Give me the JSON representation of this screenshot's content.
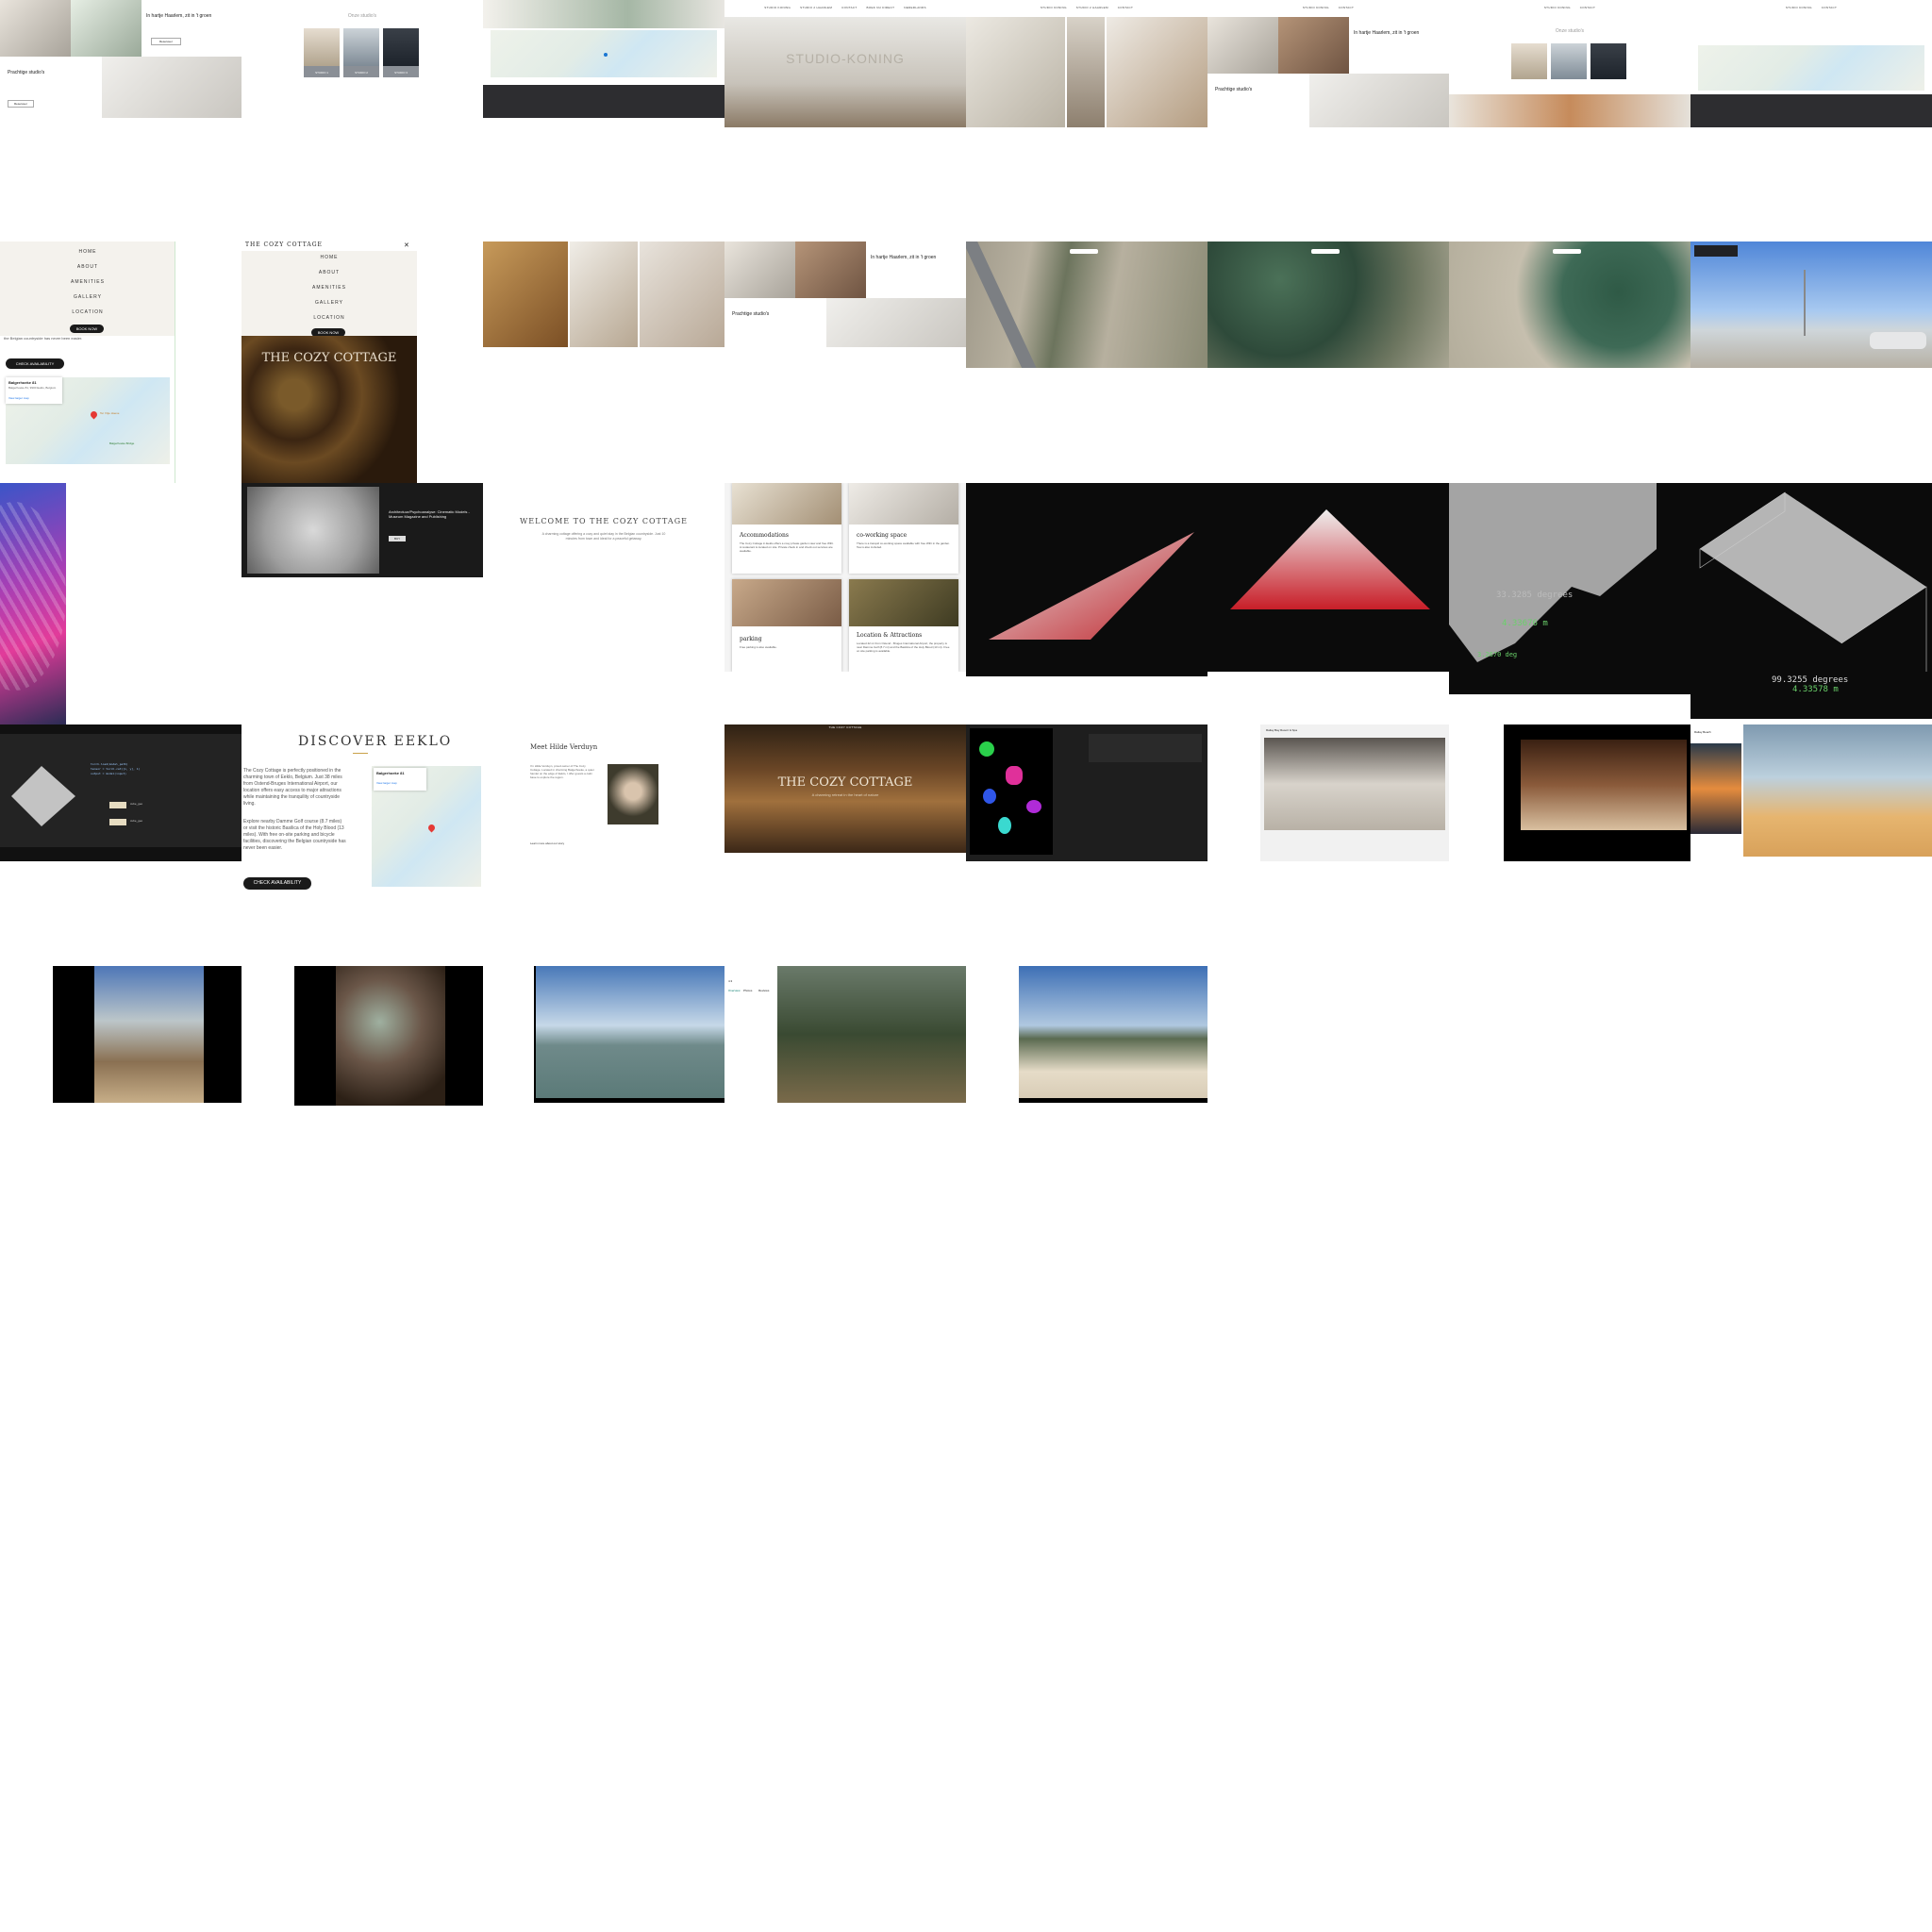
{
  "studio": {
    "nav_items": [
      "STUDIO KONING",
      "STUDIO 2 HAARLEM",
      "CONTACT",
      "BOEK NU DIRECT",
      "NEDERLANDS"
    ],
    "hero_title": "STUDIO-KONING",
    "heading_green": "In hartje Haarlem, zit in 't groen",
    "heading_studios": "Prachtige studio's",
    "read_more": "Reserveer",
    "gallery_labels": [
      "STUDIO 1",
      "STUDIO 2",
      "STUDIO 3"
    ],
    "gallery_title": "Onze studio's"
  },
  "cozy": {
    "brand": "THE COZY COTTAGE",
    "menu": [
      "HOME",
      "ABOUT",
      "AMENITIES",
      "GALLERY",
      "LOCATION"
    ],
    "book_now": "BOOK NOW",
    "check_availability": "CHECK AVAILABILITY",
    "countryside_snippet": "the Belgian countryside has never been easier.",
    "welcome_title": "WELCOME TO THE COZY COTTAGE",
    "welcome_text": "A charming cottage offering a cozy and quiet stay in the Belgian countryside. Just 10 minutes from town and ideal for a peaceful getaway.",
    "amenities": [
      {
        "title": "Accommodations",
        "text": "The Cozy Cottage in Eeklo offers a cosy private garden view and free WiFi. A restaurant is located on site. Private check in and check out services are available."
      },
      {
        "title": "co-working space",
        "text": "There is a tranquil co-working space available with free WiFi in the garden. Tea is also included."
      },
      {
        "title": "parking",
        "text": "Free parking is also available."
      },
      {
        "title": "Location & Attractions",
        "text": "Located 42 mi from Ostend - Bruges International Airport, the property is near Damme Golf (8.7 mi) and the Basilica of the Holy Blood (13 mi). Free on site parking is available."
      }
    ],
    "discover_title": "DISCOVER EEKLO",
    "discover_p1": "The Cozy Cottage is perfectly positioned in the charming town of Eeklo, Belgium. Just 38 miles from Ostend-Bruges International Airport, our location offers easy access to major attractions while maintaining the tranquility of countryside living.",
    "discover_p2": "Explore nearby Damme Golf course (8.7 miles) or visit the historic Basilica of the Holy Blood (13 miles). With free on-site parking and bicycle facilities, discovering the Belgian countryside has never been easier.",
    "map_place": "Balgerhoeke 81",
    "map_address": "Balgerhoeke 81, 9900 Eeklo, Belgium",
    "map_link": "View larger map",
    "map_pins": [
      "Ter Vrije Hoeve",
      "Balgerhoeke Bridge"
    ],
    "meet_title": "Meet Hilde Verduyn",
    "meet_text": "I'm Hilde Verduyn, proud owner of The Cozy Cottage. Located in charming Balgerhoeke, a quiet hamlet on the edge of Eeklo, I offer guests a calm base to explore the region.",
    "meet_link": "Learn more about our story",
    "hero_caption": "A charming retreat in the heart of nature"
  },
  "product": {
    "title": "Architectuur/Psychoanalyse: Cinematic Models - Museum Magazine and Publishing",
    "button": "BUY"
  },
  "angles": {
    "label_a": "33.3285 degrees",
    "label_b": "4.33676 m",
    "label_c": "3.2670 deg",
    "label_d": "99.3255 degrees",
    "label_e": "4.33578 m"
  },
  "editor": {
    "node_labels": [
      "cube_geo",
      "cube_geo"
    ],
    "code_lines": [
      "torch.load(model_path)",
      "tensor = torch.cat([x, y], 1)",
      "output = model(input)"
    ]
  },
  "maps": {
    "hotel_name": "Railay Bay Resort & Spa",
    "rating": "4.3",
    "beach_label": "Railay Beach",
    "photo_tabs": [
      "Overview",
      "Photos",
      "Reviews"
    ]
  },
  "colors": {
    "accent_gold": "#c9a24a",
    "dark_button": "#1a1a1a",
    "map_pin": "#e53935",
    "maps_teal": "#00796b"
  }
}
